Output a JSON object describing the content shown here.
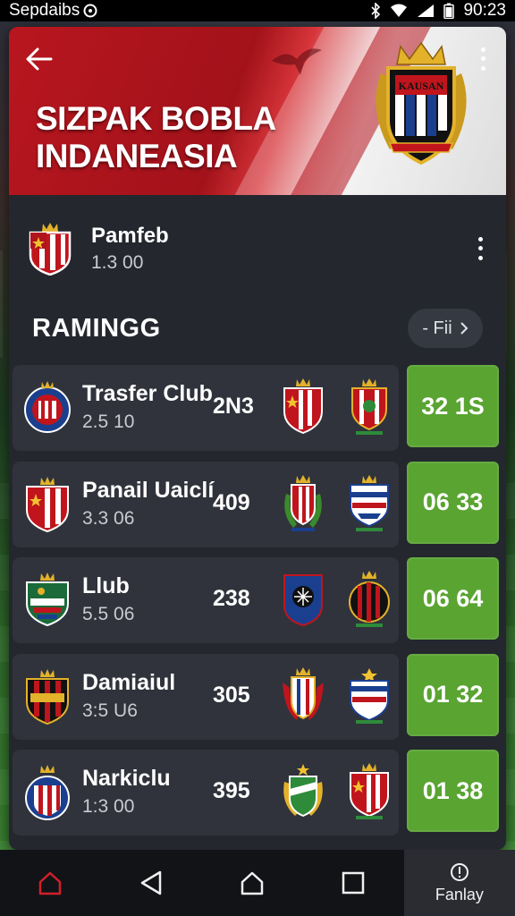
{
  "status_bar": {
    "left_text": "Sepdaibs",
    "time": "90:23"
  },
  "header": {
    "title_line1": "SIZPAK BOBLA",
    "title_line2": "INDANEASIA",
    "crest_text": "KAUSAN"
  },
  "featured": {
    "name": "Pamfeb",
    "sub": "1.3 00"
  },
  "section": {
    "title": "RAMINGG",
    "filter_label": "- Fii"
  },
  "rows": [
    {
      "name": "Trasfer Club",
      "sub": "2.5 10",
      "score": "2N3",
      "result": "32 1S"
    },
    {
      "name": "Panail Uaiclí",
      "sub": "3.3 06",
      "score": "409",
      "result": "06 33"
    },
    {
      "name": "Llub",
      "sub": "5.5 06",
      "score": "238",
      "result": "06 64"
    },
    {
      "name": "Damiaiul",
      "sub": "3:5 U6",
      "score": "305",
      "result": "01 32"
    },
    {
      "name": "Narkiclu",
      "sub": "1:3 00",
      "score": "395",
      "result": "01 38"
    }
  ],
  "bottom_nav": {
    "last_label": "Fanlay"
  },
  "colors": {
    "accent_green": "#5aa432",
    "hero_red": "#b8161f",
    "card_bg": "#24272e",
    "row_bg": "#30333b",
    "home_icon_red": "#d0202a"
  }
}
